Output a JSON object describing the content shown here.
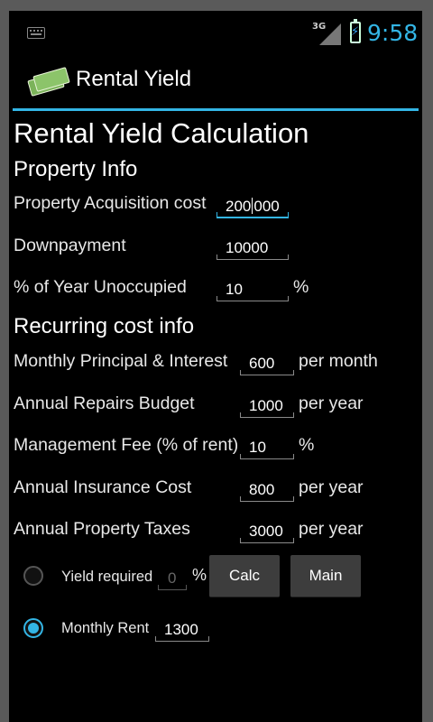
{
  "status_bar": {
    "network": "3G",
    "time": "9:58"
  },
  "action_bar": {
    "title": "Rental Yield"
  },
  "form": {
    "heading": "Rental Yield Calculation",
    "property_section": {
      "heading": "Property Info",
      "acquisition": {
        "label": "Property Acquisition cost",
        "value_before_cursor": "200",
        "value_after_cursor": "000"
      },
      "downpayment": {
        "label": "Downpayment",
        "value": "10000"
      },
      "unoccupied": {
        "label": "% of Year Unoccupied",
        "value": "10",
        "suffix": "%"
      }
    },
    "recurring_section": {
      "heading": "Recurring cost info",
      "principal": {
        "label": "Monthly Principal & Interest",
        "value": "600",
        "suffix": "per month"
      },
      "repairs": {
        "label": "Annual Repairs Budget",
        "value": "1000",
        "suffix": "per year"
      },
      "management": {
        "label": "Management Fee (% of rent)",
        "value": "10",
        "suffix": "%"
      },
      "insurance": {
        "label": "Annual Insurance Cost",
        "value": "800",
        "suffix": "per year"
      },
      "taxes": {
        "label": "Annual Property Taxes",
        "value": "3000",
        "suffix": "per year"
      }
    },
    "yield_option": {
      "label": "Yield required",
      "value": "0",
      "suffix": "%",
      "selected": false
    },
    "rent_option": {
      "label": "Monthly Rent",
      "value": "1300",
      "selected": true
    },
    "buttons": {
      "calc": "Calc",
      "main": "Main"
    }
  },
  "colors": {
    "accent": "#33b5e5",
    "background": "#000000",
    "button": "#3d3d3d"
  },
  "icons": [
    "keyboard-icon",
    "signal-icon",
    "battery-charging-icon",
    "money-icon"
  ]
}
